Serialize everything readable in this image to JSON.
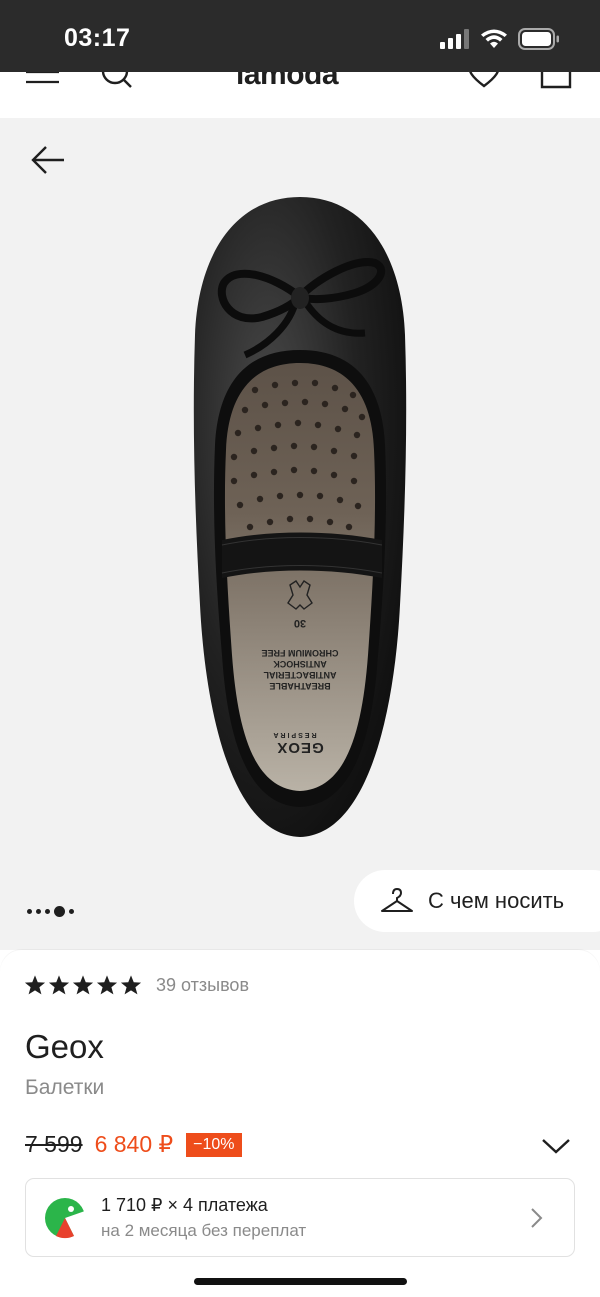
{
  "status_bar": {
    "time": "03:17"
  },
  "header": {
    "logo": "lamoda"
  },
  "gallery": {
    "outfit_label": "С чем носить"
  },
  "product": {
    "rating_stars": 5,
    "reviews": "39 отзывов",
    "brand": "Geox",
    "category": "Балетки",
    "old_price": "7 599",
    "new_price": "6 840 ₽",
    "discount": "−10%",
    "insole_text": {
      "size": "30",
      "features": [
        "BREATHABLE",
        "ANTIBACTERIAL",
        "ANTISHOCK",
        "CHROMIUM FREE"
      ],
      "logo": "GEOX",
      "sub_logo": "RESPIRA"
    }
  },
  "installments": {
    "title": "1 710 ₽ × 4 платежа",
    "subtitle": "на 2 месяца без переплат"
  },
  "colors": {
    "accent": "#ee4d1b",
    "status_bar": "#2b2b2b",
    "gallery_bg": "#f2f2f2"
  }
}
